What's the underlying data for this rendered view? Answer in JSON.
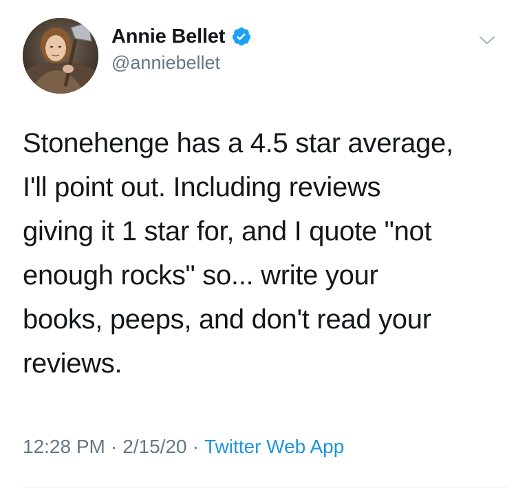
{
  "user": {
    "display_name": "Annie Bellet",
    "handle": "@anniebellet",
    "verified": true,
    "verified_icon": "verified-badge-icon",
    "avatar_icon": "profile-photo"
  },
  "menu": {
    "icon": "chevron-down-icon"
  },
  "tweet": {
    "lines": [
      "Stonehenge has a 4.5 star average,",
      "I'll point out. Including reviews",
      "giving it 1 star for, and I quote \"not",
      "enough rocks\" so... write your",
      "books, peeps, and don't read your",
      "reviews."
    ]
  },
  "meta": {
    "time": "12:28 PM",
    "date": "2/15/20",
    "separator": "·",
    "source": "Twitter Web App"
  },
  "colors": {
    "text": "#14171a",
    "secondary": "#657786",
    "accent": "#1b95e0",
    "verified": "#1da1f2",
    "divider": "#e1e8ed"
  }
}
